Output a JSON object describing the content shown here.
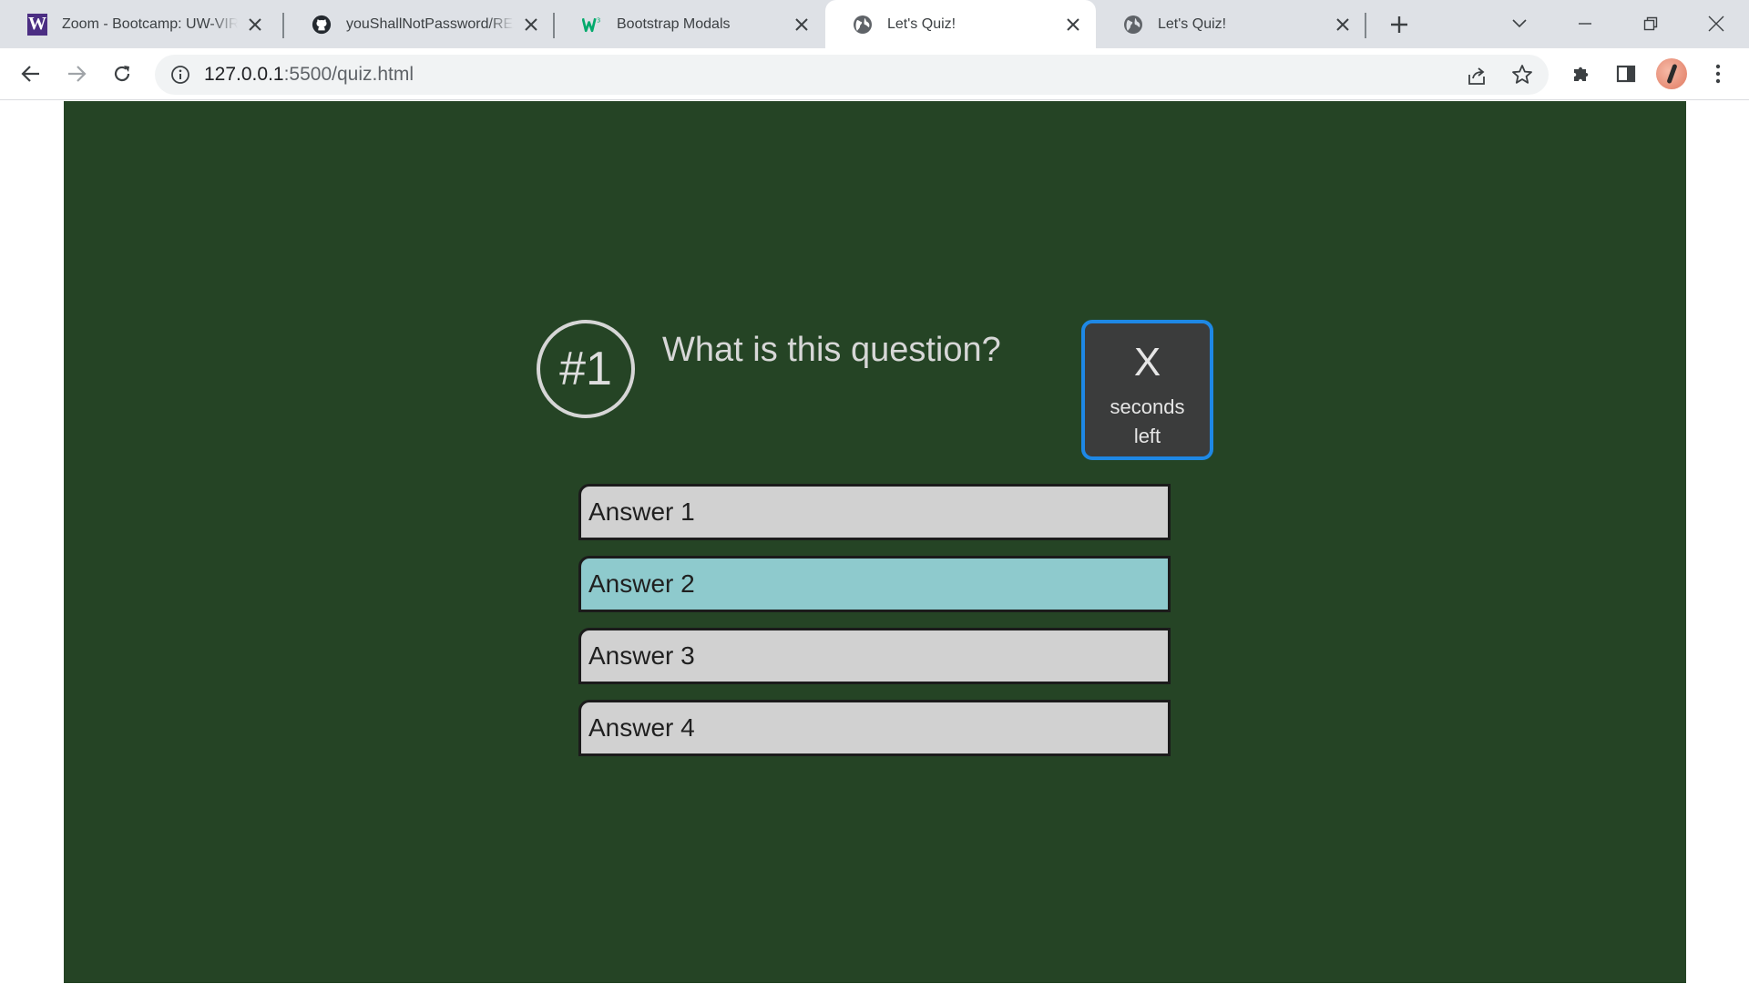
{
  "browser": {
    "tabs": [
      {
        "title": "Zoom - Bootcamp: UW-VIRT",
        "favicon": "uw-w-icon",
        "active": false
      },
      {
        "title": "youShallNotPassword/README",
        "favicon": "github-icon",
        "active": false
      },
      {
        "title": "Bootstrap Modals",
        "favicon": "w3schools-icon",
        "active": false
      },
      {
        "title": "Let's Quiz!",
        "favicon": "globe-icon",
        "active": true
      },
      {
        "title": "Let's Quiz!",
        "favicon": "globe-icon",
        "active": false
      }
    ],
    "address_bar": {
      "host": "127.0.0.1",
      "path": ":5500/quiz.html"
    },
    "colors": {
      "tabstrip": "#dee1e6",
      "omnibox": "#f1f3f4"
    }
  },
  "quiz": {
    "question_number": "#1",
    "question_text": "What is this question?",
    "timer": {
      "value": "X",
      "label": "seconds left"
    },
    "answers": [
      {
        "label": "Answer 1",
        "selected": false
      },
      {
        "label": "Answer 2",
        "selected": true
      },
      {
        "label": "Answer 3",
        "selected": false
      },
      {
        "label": "Answer 4",
        "selected": false
      }
    ],
    "colors": {
      "background": "#254425",
      "answer": "#d1d1d1",
      "answer_selected": "#8ecacd",
      "timer_border": "#1e88e5",
      "timer_bg": "#3b3c3c"
    }
  }
}
